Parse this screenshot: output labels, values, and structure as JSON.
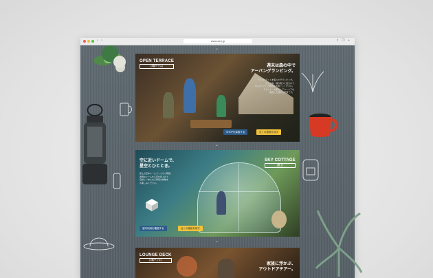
{
  "browser": {
    "url": "www.aeo.jp",
    "nav": [
      "‹",
      "›"
    ]
  },
  "sections": [
    {
      "title_en": "OPEN TERRACE",
      "title_jp": "(3階テラス)",
      "catch": [
        "週末は森の中で",
        "アーバングランピング。"
      ],
      "body": [
        "テラスにテントを張ったグランピング。",
        "大きな庭、緑の香りに包まれて",
        "ゆったりとした時間をお過ごしください。",
        "デザイナーズ家具とアウトドアを",
        "融合した贅沢な空間です。"
      ],
      "buttons": [
        "SHOPを探索する",
        "近くの施設を探す"
      ]
    },
    {
      "title_en": "SKY COTTAGE",
      "title_jp": "(屋上)",
      "catch": [
        "空に近いドームで、",
        "星空とひととき。"
      ],
      "body": [
        "屋上の空中ドームでくつろぐ時間。",
        "透明なドームから空を見上げて",
        "自然と一体になる特別な体験を",
        "お楽しみください。"
      ],
      "buttons": [
        "室内利用を確認する",
        "近くの施設を探す"
      ]
    },
    {
      "title_en": "LOUNGE DECK",
      "title_jp": "(1階デッキ)",
      "catch": [
        "家族に浮かぶ、",
        "アウトドアチアー。"
      ]
    }
  ]
}
